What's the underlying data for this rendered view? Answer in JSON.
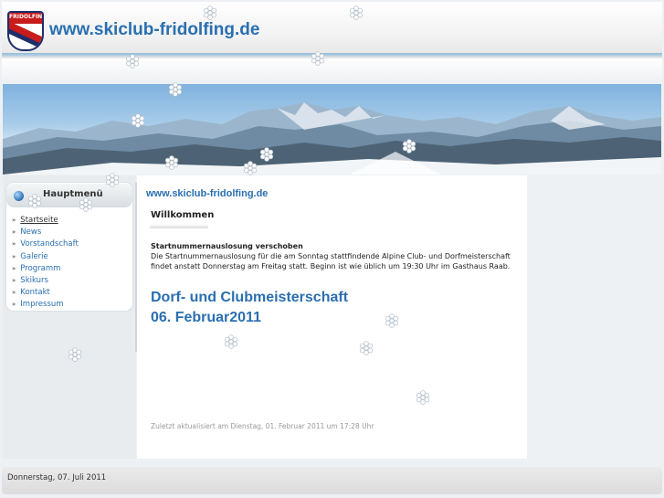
{
  "header": {
    "site_title": "www.skiclub-fridolfing.de",
    "logo_text": "FRIDOLFING",
    "logo_text2": "SKICLUB"
  },
  "sidebar": {
    "menu_title": "Hauptmenü",
    "items": [
      {
        "label": "Startseite",
        "active": true
      },
      {
        "label": "News"
      },
      {
        "label": "Vorstandschaft"
      },
      {
        "label": "Galerie"
      },
      {
        "label": "Programm"
      },
      {
        "label": "Skikurs"
      },
      {
        "label": "Kontakt"
      },
      {
        "label": "Impressum"
      }
    ]
  },
  "content": {
    "site_link": "www.skiclub-fridolfing.de",
    "article_title": "Willkommen",
    "news_head": "Startnummernauslosung verschoben",
    "news_body": "Die Startnummernauslosung für die am Sonntag stattfindende Alpine Club- und Dorfmeisterschaft findet anstatt Donnerstag am Freitag statt. Beginn ist wie üblich um 19:30 Uhr im Gasthaus Raab.",
    "big_title_line1": "Dorf- und Clubmeisterschaft",
    "big_title_line2": "06. Februar2011",
    "updated": "Zuletzt aktualisiert am Dienstag, 01. Februar 2011 um 17:28 Uhr"
  },
  "footer": {
    "date": "Donnerstag, 07. Juli 2011"
  },
  "icons": {
    "bullet": "menu-bullet-icon",
    "arrow": "double-chevron-icon",
    "decor": "snowflake-icon"
  },
  "colors": {
    "accent": "#2a6fb0",
    "background": "#eef1f4"
  }
}
